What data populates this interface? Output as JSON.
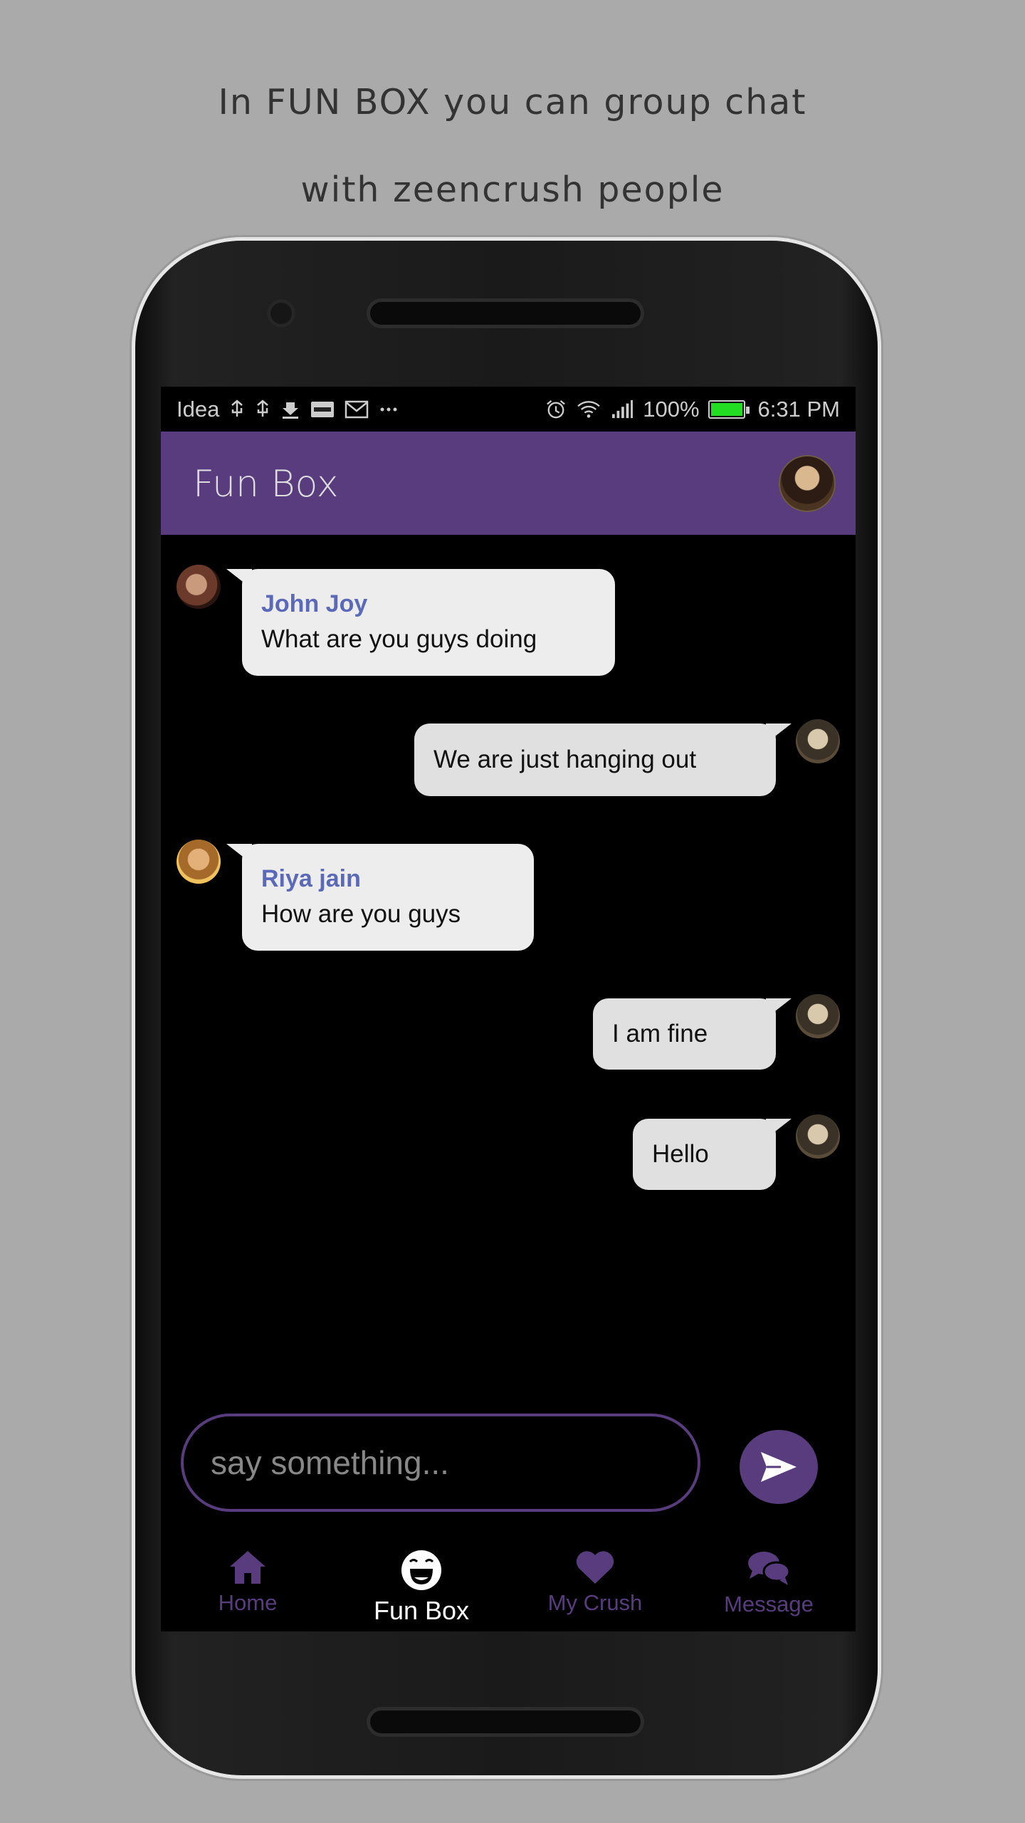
{
  "caption": {
    "line1": "In FUN BOX you can group chat",
    "line2": "with zeencrush people"
  },
  "statusbar": {
    "carrier": "Idea",
    "battery_percent": "100%",
    "battery_level": 1.0,
    "time": "6:31 PM",
    "battery_color": "#22dd22"
  },
  "appbar": {
    "title": "Fun Box",
    "color": "#583c7e"
  },
  "messages": [
    {
      "direction": "incoming",
      "sender": "John Joy",
      "text": "What are you guys doing"
    },
    {
      "direction": "outgoing",
      "text": "We are just hanging out"
    },
    {
      "direction": "incoming",
      "sender": "Riya jain",
      "text": "How are you guys"
    },
    {
      "direction": "outgoing",
      "text": "I am fine"
    },
    {
      "direction": "outgoing",
      "text": "Hello"
    }
  ],
  "composer": {
    "placeholder": "say something...",
    "send_icon": "send-icon"
  },
  "bottomnav": {
    "items": [
      {
        "label": "Home",
        "icon": "home-icon",
        "active": false
      },
      {
        "label": "Fun Box",
        "icon": "laughing-face-icon",
        "active": true
      },
      {
        "label": "My Crush",
        "icon": "heart-icon",
        "active": false
      },
      {
        "label": "Message",
        "icon": "chat-bubbles-icon",
        "active": false
      }
    ]
  }
}
